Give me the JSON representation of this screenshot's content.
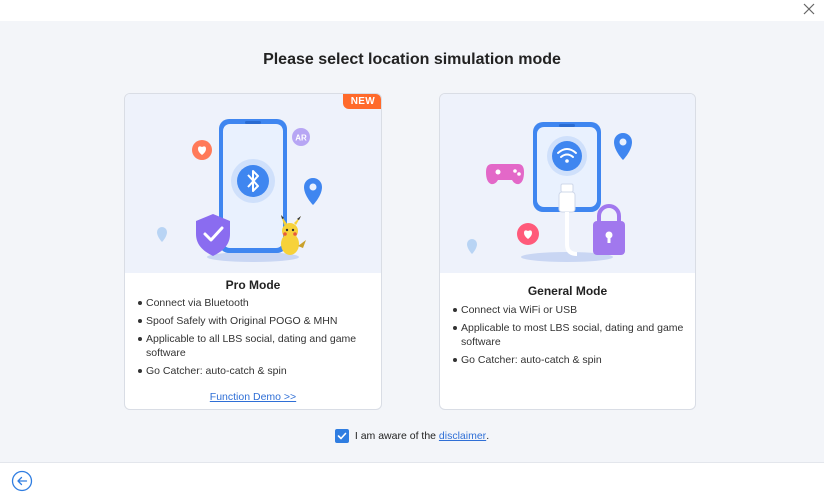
{
  "dialog": {
    "title": "Please select location simulation mode",
    "close_icon": "close-icon",
    "back_icon": "back-arrow-circle-icon"
  },
  "pro_mode": {
    "badge": "NEW",
    "title": "Pro Mode",
    "features": [
      "Connect via Bluetooth",
      "Spoof Safely with Original POGO & MHN",
      "Applicable to all LBS social, dating and game software",
      "Go Catcher: auto-catch & spin"
    ],
    "demo_link": "Function Demo >>",
    "illustration_icons": [
      "phone-icon",
      "bluetooth-icon",
      "shield-icon",
      "heart-icon",
      "ar-icon",
      "location-pin-icon",
      "pikachu-icon"
    ]
  },
  "general_mode": {
    "title": "General Mode",
    "features": [
      "Connect via WiFi or USB",
      "Applicable to most LBS social, dating and game software",
      "Go Catcher: auto-catch & spin"
    ],
    "illustration_icons": [
      "phone-icon",
      "wifi-icon",
      "usb-cable-icon",
      "lock-icon",
      "gamepad-icon",
      "heart-icon",
      "location-pin-icon"
    ]
  },
  "agreement": {
    "checked": true,
    "prefix": "I am aware of the ",
    "link": "disclaimer",
    "suffix": "."
  },
  "colors": {
    "accent": "#2f7de1",
    "link": "#2f6fd6",
    "badge": "#ff6a2b",
    "panel_background": "#f3f5f9"
  }
}
